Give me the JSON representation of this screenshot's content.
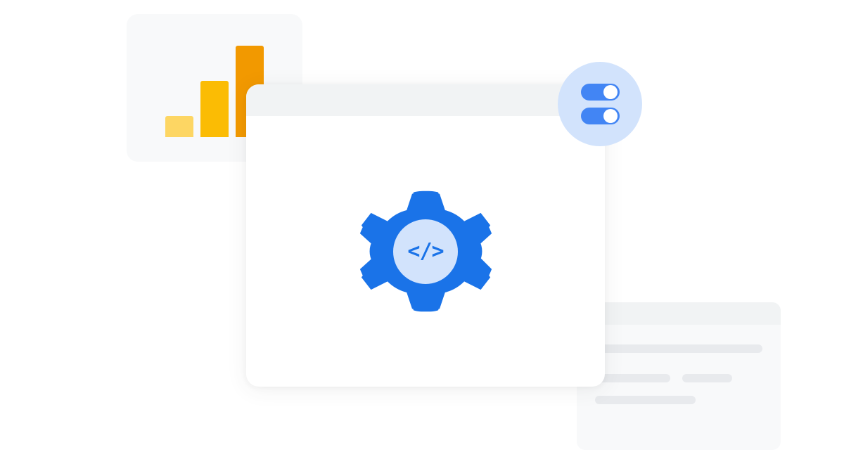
{
  "chart_data": {
    "type": "bar",
    "categories": [
      "bar1",
      "bar2",
      "bar3"
    ],
    "values": [
      30,
      80,
      130
    ],
    "colors": [
      "#fdd663",
      "#fbbc04",
      "#f29900"
    ]
  },
  "gear": {
    "color": "#1a73e8",
    "center_bg": "#d2e3fc",
    "code_symbol": "</>"
  },
  "toggles": {
    "badge_bg": "#d2e3fc",
    "track_color": "#4285f4",
    "toggle1_state": "on",
    "toggle2_state": "on"
  },
  "colors": {
    "card_bg": "#f8f9fa",
    "header_bg": "#f1f3f4",
    "line_bg": "#e8eaed"
  }
}
